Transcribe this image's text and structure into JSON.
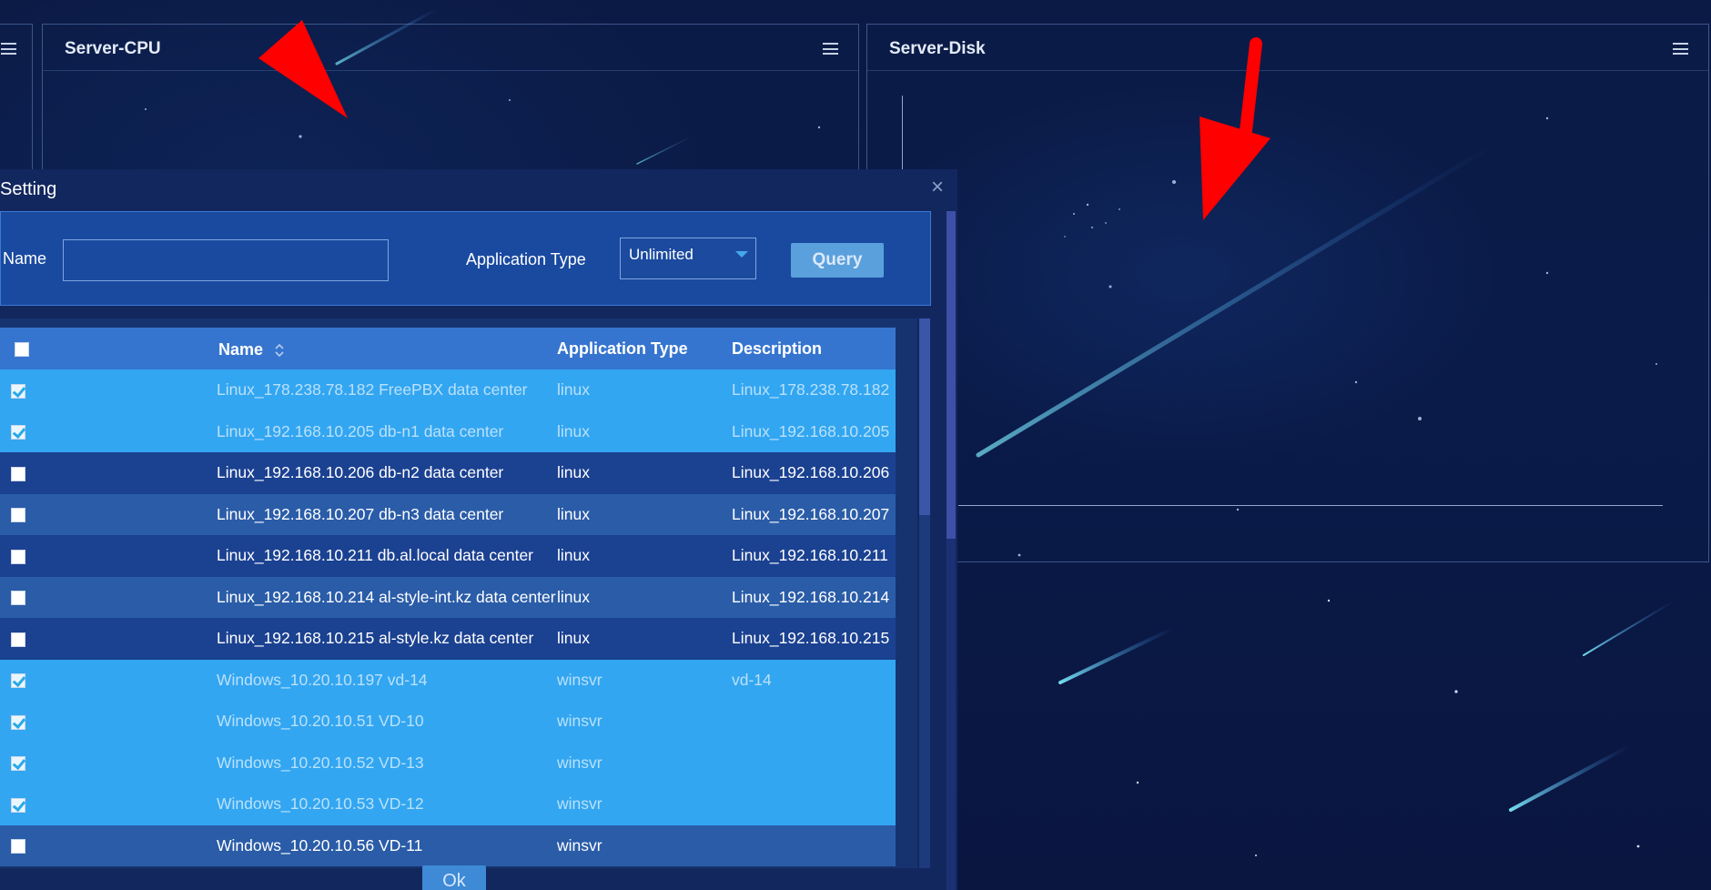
{
  "panels": {
    "cpu": {
      "title": "Server-CPU"
    },
    "disk": {
      "title": "Server-Disk"
    }
  },
  "dialog": {
    "title": "Setting",
    "close_glyph": "×",
    "filter": {
      "name_label": "Name",
      "name_value": "",
      "apptype_label": "Application Type",
      "apptype_value": "Unlimited",
      "query_label": "Query"
    },
    "grid": {
      "columns": [
        "Name",
        "Application Type",
        "Description"
      ],
      "rows": [
        {
          "checked": true,
          "name": "Linux_178.238.78.182 FreePBX data center",
          "type": "linux",
          "desc": "Linux_178.238.78.182"
        },
        {
          "checked": true,
          "name": "Linux_192.168.10.205 db-n1 data center",
          "type": "linux",
          "desc": "Linux_192.168.10.205"
        },
        {
          "checked": false,
          "name": "Linux_192.168.10.206 db-n2 data center",
          "type": "linux",
          "desc": "Linux_192.168.10.206"
        },
        {
          "checked": false,
          "name": "Linux_192.168.10.207 db-n3 data center",
          "type": "linux",
          "desc": "Linux_192.168.10.207"
        },
        {
          "checked": false,
          "name": "Linux_192.168.10.211 db.al.local data center",
          "type": "linux",
          "desc": "Linux_192.168.10.211"
        },
        {
          "checked": false,
          "name": "Linux_192.168.10.214 al-style-int.kz data center",
          "type": "linux",
          "desc": "Linux_192.168.10.214"
        },
        {
          "checked": false,
          "name": "Linux_192.168.10.215 al-style.kz data center",
          "type": "linux",
          "desc": "Linux_192.168.10.215"
        },
        {
          "checked": true,
          "name": "Windows_10.20.10.197 vd-14",
          "type": "winsvr",
          "desc": "vd-14"
        },
        {
          "checked": true,
          "name": "Windows_10.20.10.51 VD-10",
          "type": "winsvr",
          "desc": ""
        },
        {
          "checked": true,
          "name": "Windows_10.20.10.52 VD-13",
          "type": "winsvr",
          "desc": ""
        },
        {
          "checked": true,
          "name": "Windows_10.20.10.53 VD-12",
          "type": "winsvr",
          "desc": ""
        },
        {
          "checked": false,
          "name": "Windows_10.20.10.56 VD-11",
          "type": "winsvr",
          "desc": ""
        }
      ]
    },
    "ok_label": "Ok"
  },
  "colors": {
    "background": "#0b1a44",
    "dialog": "#13275f",
    "header_row": "#3675cf",
    "selected_row": "#33a6f1",
    "arrow": "#ff0000"
  }
}
